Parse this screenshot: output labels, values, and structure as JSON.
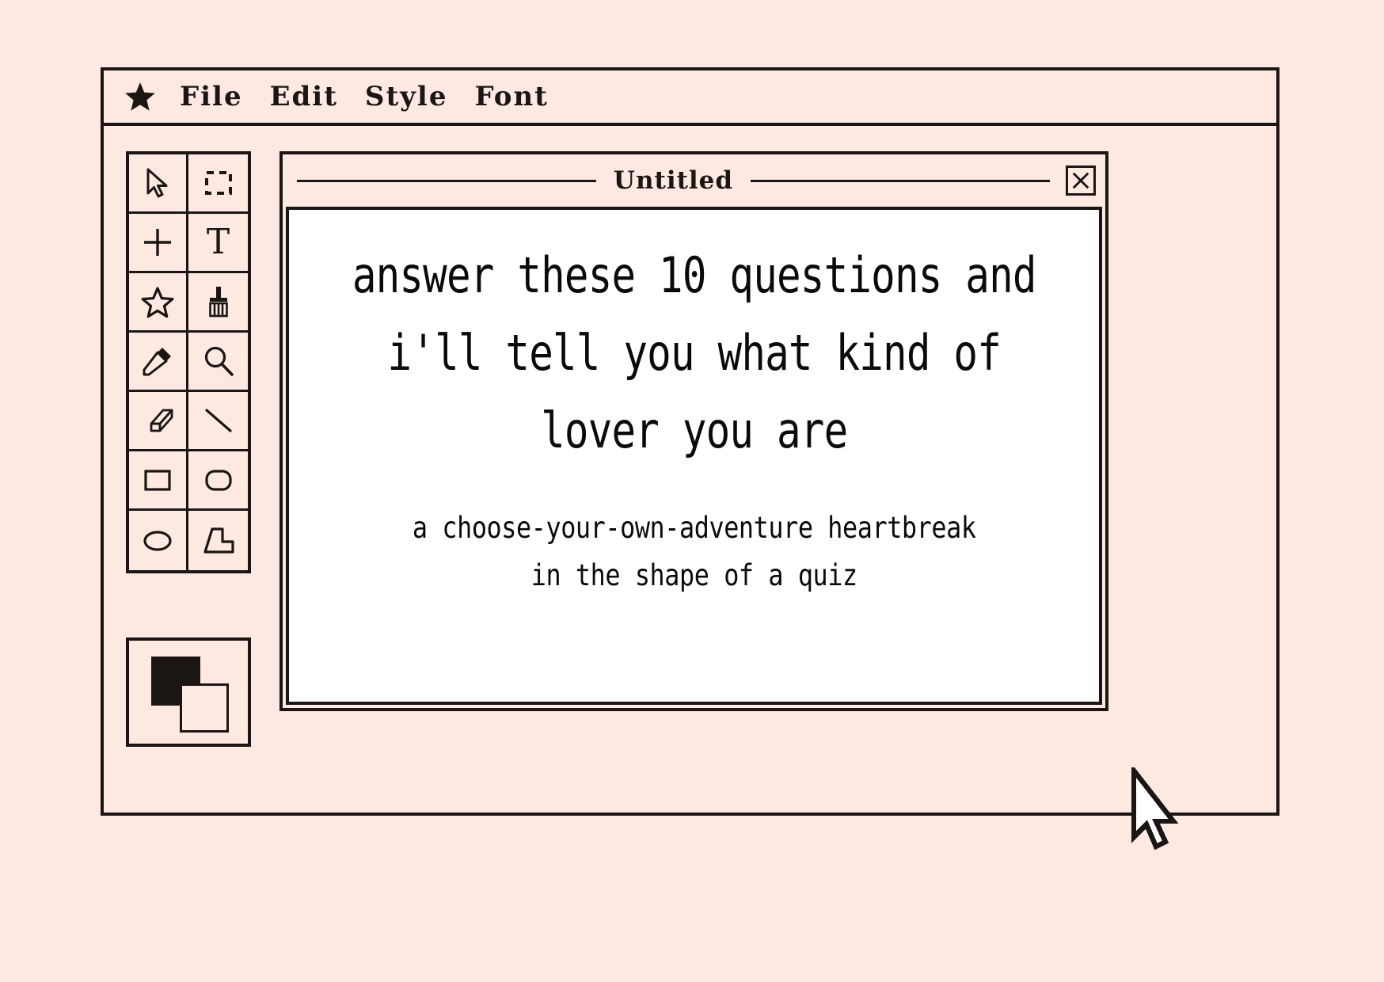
{
  "canvas": {
    "background_color": "#fde9e2",
    "ink_color": "#1b1613",
    "paper_color": "#ffffff"
  },
  "menu_bar": {
    "logo_icon": "star-icon",
    "items": [
      {
        "label": "File"
      },
      {
        "label": "Edit"
      },
      {
        "label": "Style"
      },
      {
        "label": "Font"
      }
    ]
  },
  "tool_palette": {
    "tools": [
      {
        "icon": "arrow-pointer-icon",
        "label": "Select"
      },
      {
        "icon": "marquee-selection-icon",
        "label": "Marquee"
      },
      {
        "icon": "crosshair-icon",
        "label": "Crosshair"
      },
      {
        "icon": "text-tool-icon",
        "label": "T"
      },
      {
        "icon": "star-outline-icon",
        "label": "Star"
      },
      {
        "icon": "paintbrush-icon",
        "label": "Brush"
      },
      {
        "icon": "pencil-icon",
        "label": "Pencil"
      },
      {
        "icon": "magnifier-icon",
        "label": "Zoom"
      },
      {
        "icon": "eraser-icon",
        "label": "Eraser"
      },
      {
        "icon": "line-tool-icon",
        "label": "Line"
      },
      {
        "icon": "rectangle-icon",
        "label": "Rectangle"
      },
      {
        "icon": "rounded-rectangle-icon",
        "label": "Rounded Rectangle"
      },
      {
        "icon": "ellipse-icon",
        "label": "Ellipse"
      },
      {
        "icon": "polygon-icon",
        "label": "Polygon"
      }
    ]
  },
  "color_swatch": {
    "foreground_color": "#1b1613",
    "background_color": "#fde9e2"
  },
  "document_window": {
    "title": "Untitled",
    "close_icon": "close-x-icon",
    "content": {
      "headline_lines": [
        "answer these 10 questions and",
        "i'll tell you what kind of",
        "lover you are"
      ],
      "subtitle_lines": [
        "a choose-your-own-adventure heartbreak",
        "in the shape of a quiz"
      ]
    }
  },
  "pointer": {
    "icon": "mouse-arrow-cursor-icon"
  }
}
